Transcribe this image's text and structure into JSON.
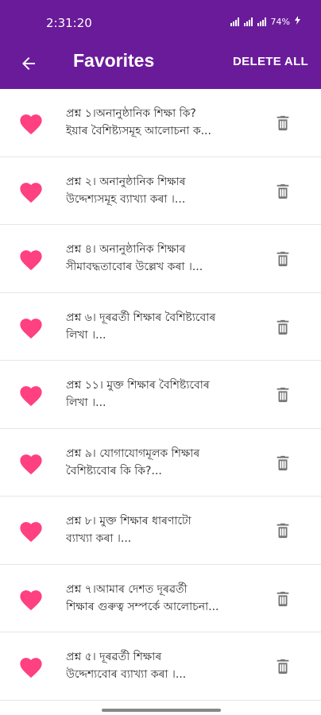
{
  "status_bar": {
    "time": "2:31:20",
    "battery": "74%"
  },
  "app_bar": {
    "title": "Favorites",
    "delete_all_label": "DELETE ALL",
    "color": "#6a1b9a"
  },
  "icons": {
    "back": "arrow-back-icon",
    "heart": "heart-icon",
    "trash": "trash-icon",
    "heart_color": "#ff4081"
  },
  "favorites": [
    {
      "line1": "প্ৰশ্ন ১।অনানুষ্ঠানিক শিক্ষা কি?",
      "line2": "ইয়াৰ বৈশিষ্ট্যসমূহ আলোচনা ক..."
    },
    {
      "line1": "প্ৰশ্ন ২। অনানুষ্ঠানিক শিক্ষাৰ",
      "line2": "উদ্দেশ্যসমূহ ব্যাখ্যা কৰা ।..."
    },
    {
      "line1": "প্ৰশ্ন ৪। অনানুষ্ঠানিক শিক্ষাৰ",
      "line2": "সীমাবদ্ধতাবোৰ উল্লেখ কৰা ।..."
    },
    {
      "line1": "প্ৰশ্ন ৬। দূৰৱৰ্তী শিক্ষাৰ বৈশিষ্ট্যবোৰ",
      "line2": "লিখা ।..."
    },
    {
      "line1": "প্ৰশ্ন ১১। মুক্ত শিক্ষাৰ বৈশিষ্ট্যবোৰ",
      "line2": "লিখা ।..."
    },
    {
      "line1": "প্ৰশ্ন ৯। যোগাযোগমূলক শিক্ষাৰ",
      "line2": "বৈশিষ্ট্যবোৰ কি কি?..."
    },
    {
      "line1": "প্ৰশ্ন ৮। মুক্ত শিক্ষাৰ ধাৰণাটো",
      "line2": "ব্যাখ্যা কৰা ।..."
    },
    {
      "line1": "প্ৰশ্ন ৭।আমাৰ দেশত দূৰৱৰ্তী",
      "line2": "শিক্ষাৰ গুৰুত্ব সম্পৰ্কে আলোচনা..."
    },
    {
      "line1": "প্ৰশ্ন ৫। দূৰৱৰ্তী শিক্ষাৰ",
      "line2": "উদ্দেশ্যবোৰ ব্যাখ্যা কৰা ।..."
    }
  ]
}
